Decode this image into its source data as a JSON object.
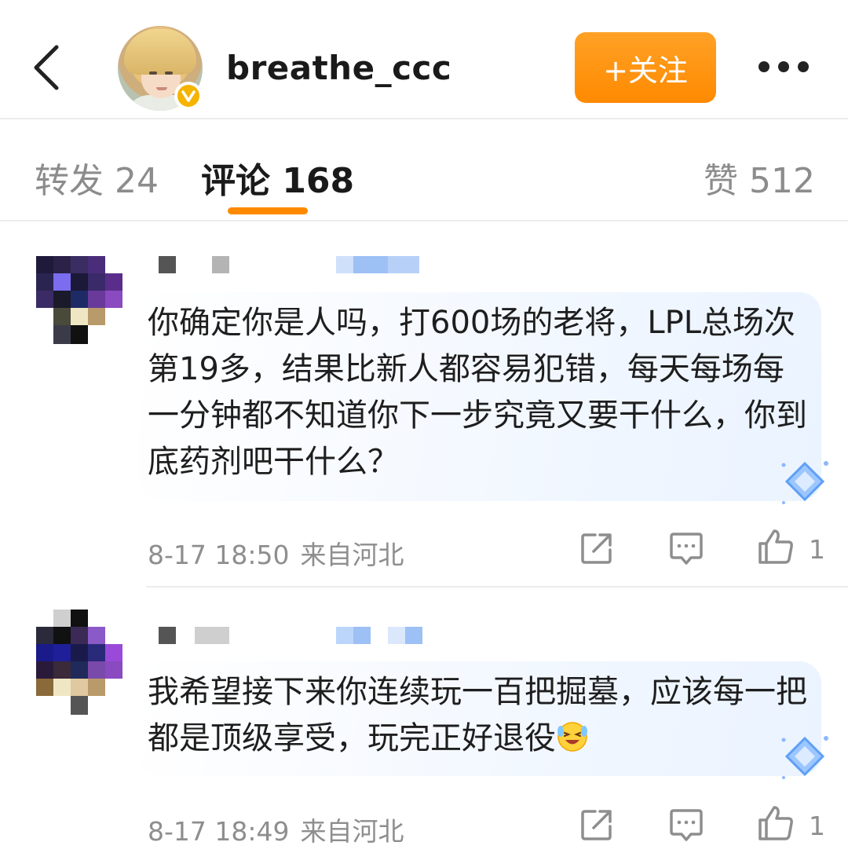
{
  "header": {
    "username": "breathe_ccc",
    "follow_label": "+关注",
    "icons": [
      "back-icon",
      "verified-badge-icon",
      "more-icon"
    ],
    "accent_color": "#ff8a00"
  },
  "tabs": {
    "reposts": "转发 24",
    "comments": "评论 168",
    "likes": "赞 512",
    "active": "comments"
  },
  "comments": [
    {
      "text": "你确定你是人吗，打600场的老将，LPL总场次第19多，结果比新人都容易犯错，每天每场每一分钟都不知道你下一步究竟又要干什么，你到底药剂吧干什么？",
      "time": "8-17 18:50",
      "location": "来自河北",
      "likes": "1"
    },
    {
      "text": "我希望接下来你连续玩一百把掘墓，应该每一把都是顶级享受，玩完正好退役",
      "time": "8-17 18:49",
      "location": "来自河北",
      "likes": "1"
    }
  ]
}
